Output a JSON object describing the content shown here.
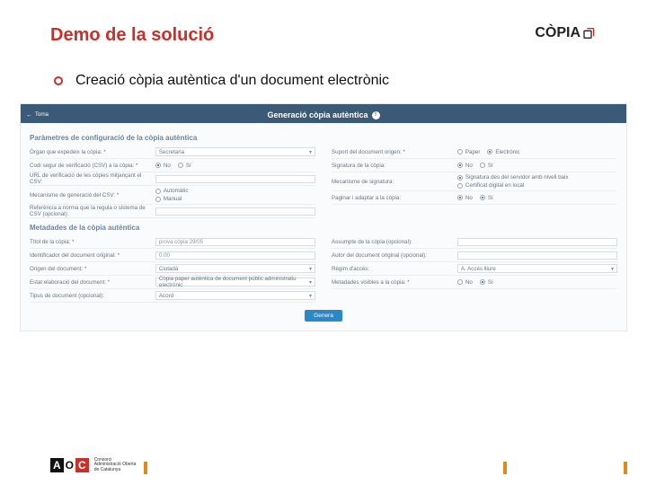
{
  "slide": {
    "title": "Demo de la solució",
    "brand": "CÒPIA",
    "bullet": "Creació còpia autèntica d'un document electrònic"
  },
  "shot": {
    "back": "Torna",
    "header": "Generació còpia autèntica",
    "sect1": "Paràmetres de configuració de la còpia autèntica",
    "sect2": "Metadades de la còpia autèntica",
    "left": {
      "organ_l": "Òrgan que expedeix la còpia: *",
      "organ_v": "Secretaria",
      "csv_l": "Codi segur de verificació (CSV) a la còpia: *",
      "csv_no": "No",
      "csv_si": "Sí",
      "url_l": "URL de verificació de les còpies mitjançant el CSV:",
      "mec_l": "Mecanisme de generació del CSV: *",
      "mec_a": "Automàtic",
      "mec_m": "Manual",
      "ref_l": "Referència a norma que la regula o sistema de CSV (opcional):"
    },
    "right": {
      "suport_l": "Suport del document origen: *",
      "suport_p": "Paper",
      "suport_e": "Electrònic",
      "sig_l": "Signatura de la còpia:",
      "sig_no": "No",
      "sig_si": "Sí",
      "mecsig_l": "Mecanisme de signatura:",
      "mecsig_a": "Signatura des del servidor amb nivell baix",
      "mecsig_b": "Certificat digital en local",
      "pag_l": "Paginar i adaptar a la còpia:",
      "pag_no": "No",
      "pag_si": "Sí"
    },
    "meta": {
      "titol_l": "Títol de la còpia: *",
      "titol_v": "prova còpia 29/05",
      "id_l": "Identificador del document original: *",
      "id_v": "0.00",
      "origen_l": "Origen del document: *",
      "origen_v": "Ciutadà",
      "estat_l": "Estat elaboració del document: *",
      "estat_v": "Còpia paper autèntica de document públic administratiu electrònic",
      "tipus_l": "Tipus de document (opcional):",
      "tipus_v": "Acord",
      "assumpte_l": "Assumpte de la còpia (opcional):",
      "autor_l": "Autor del document original (opcional):",
      "regim_l": "Règim d'accés:",
      "regim_v": "A. Accés lliure",
      "metaext_l": "Metadades visibles a la còpia: *",
      "metaext_no": "No",
      "metaext_si": "Sí"
    },
    "button": "Genera"
  },
  "footer": {
    "l1": "Consorci",
    "l2": "Administració Oberta",
    "l3": "de Catalunya"
  }
}
